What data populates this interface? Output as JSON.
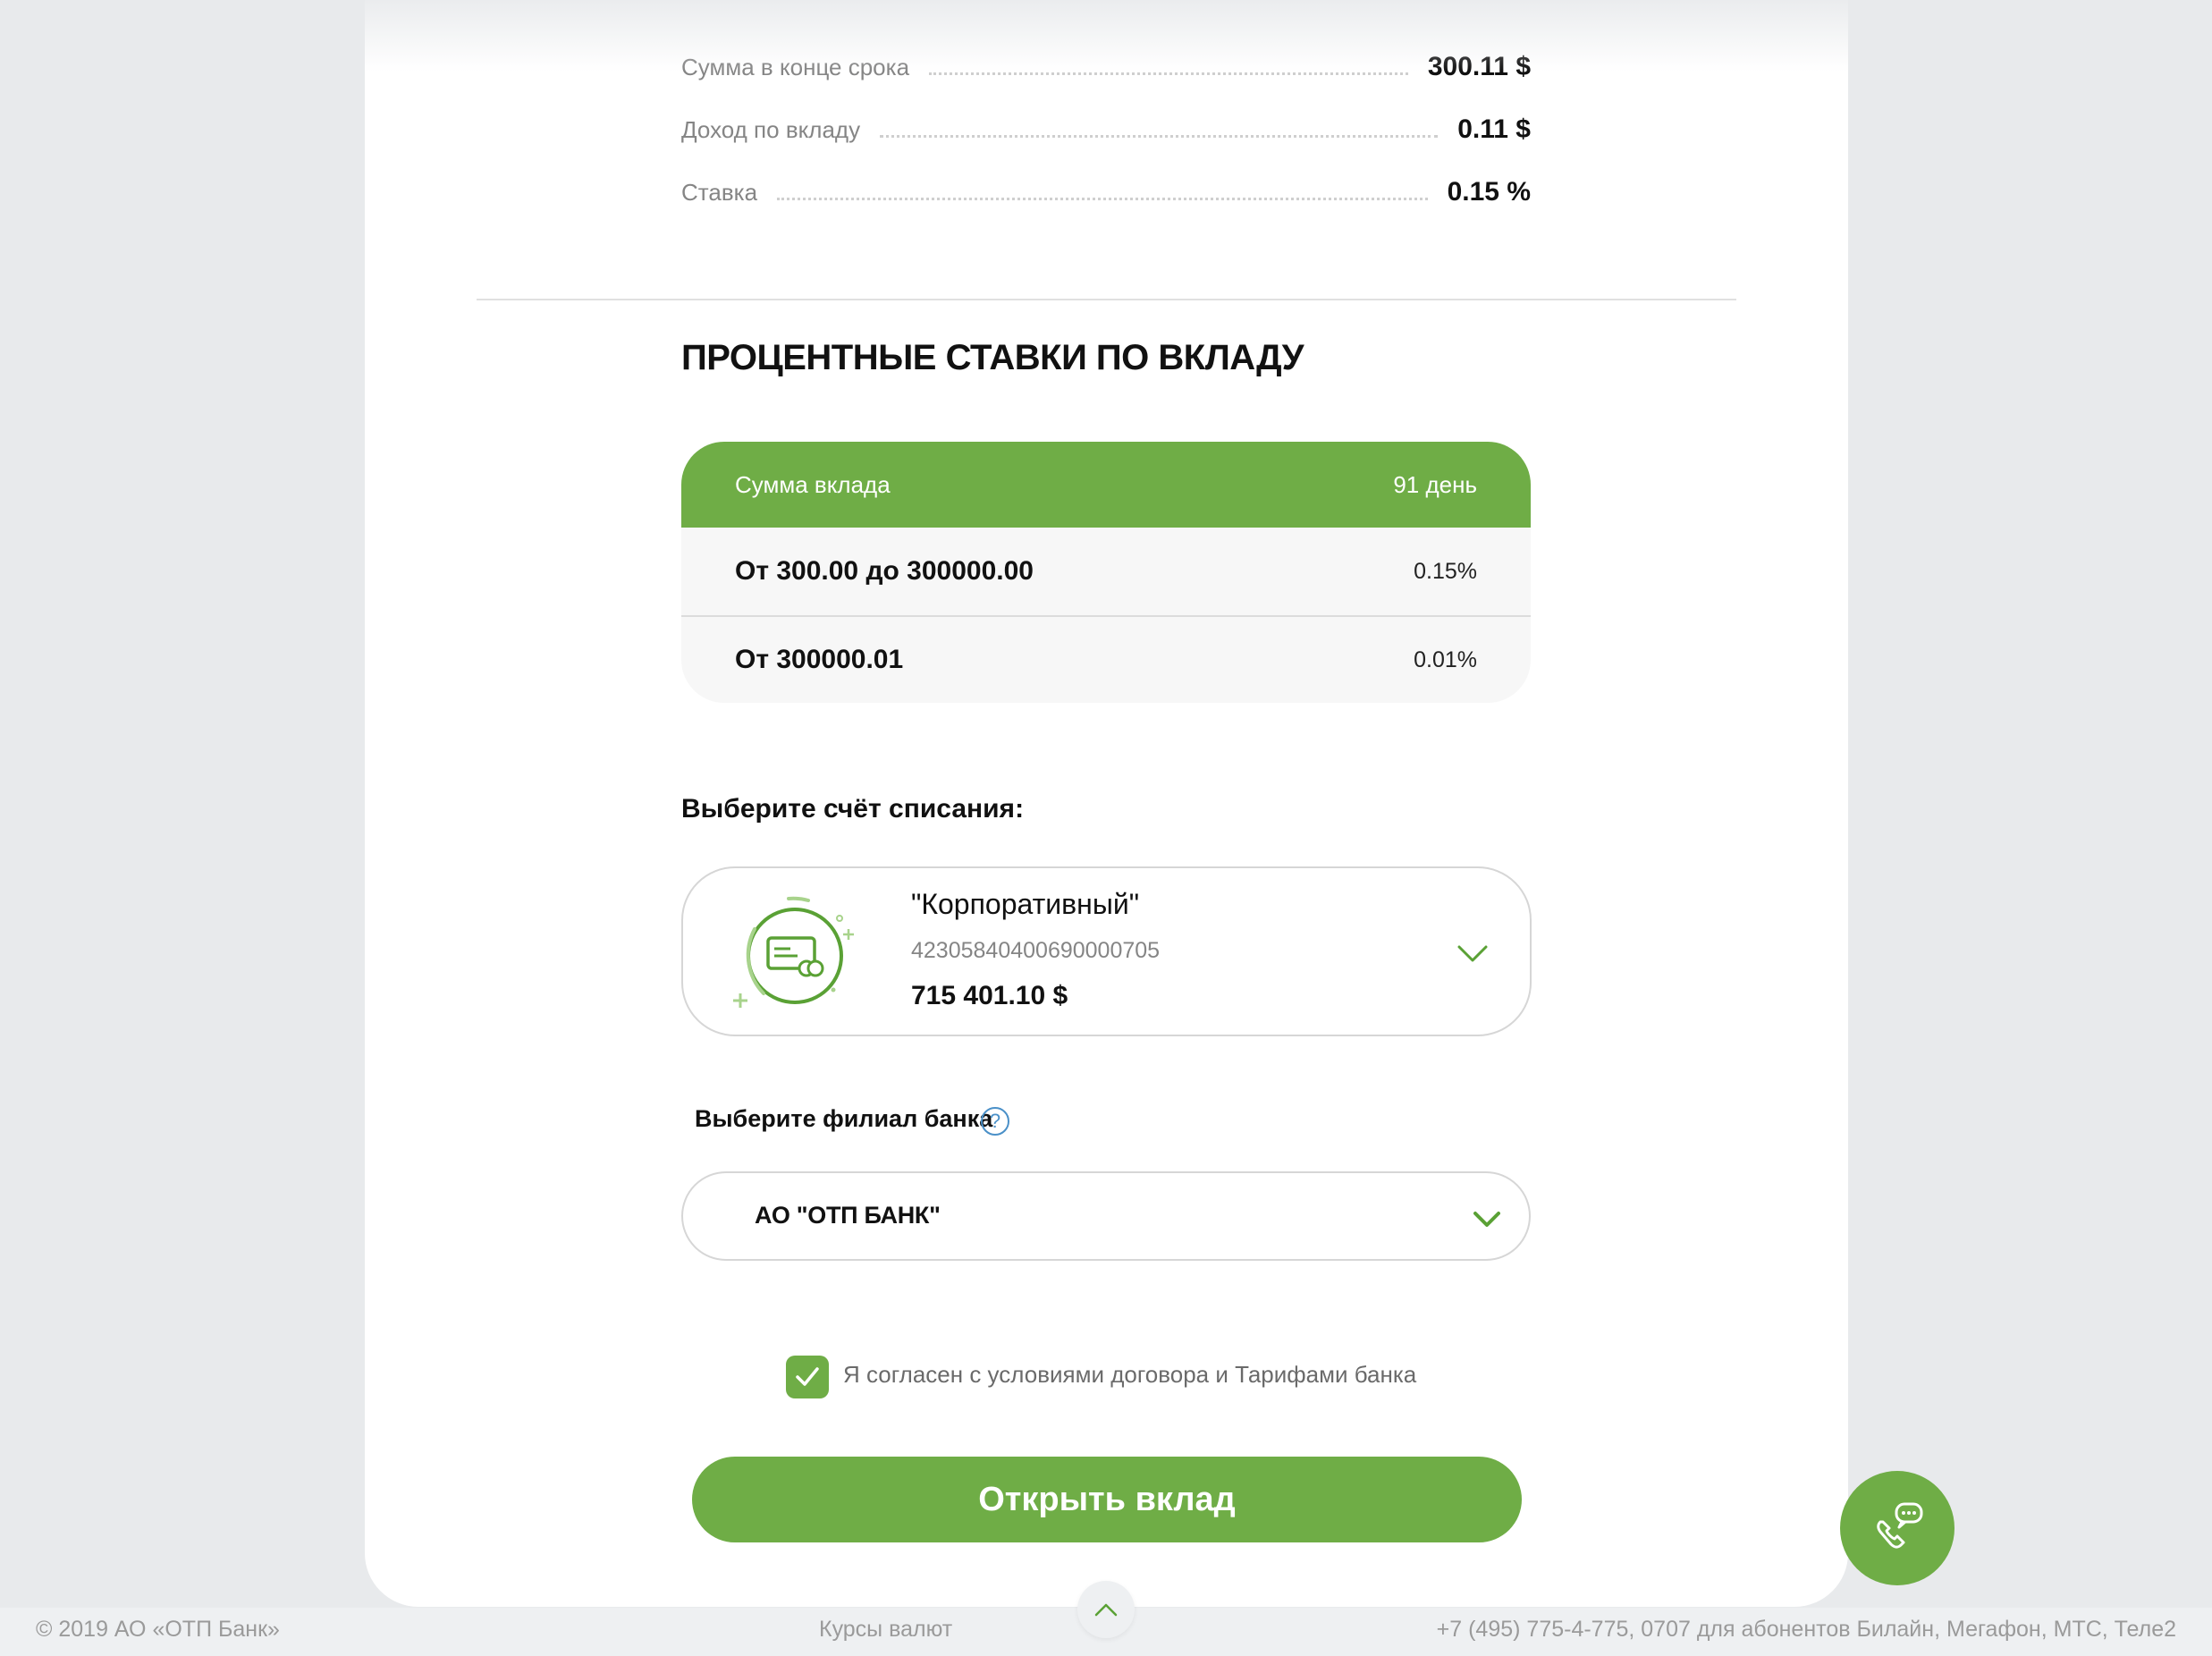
{
  "summary": {
    "rows": [
      {
        "label": "Сумма в конце срока",
        "value": "300.11 $"
      },
      {
        "label": "Доход по вкладу",
        "value": "0.11 $"
      },
      {
        "label": "Ставка",
        "value": "0.15 %"
      }
    ]
  },
  "rates": {
    "title": "ПРОЦЕНТНЫЕ СТАВКИ ПО ВКЛАДУ",
    "header": {
      "amount": "Сумма вклада",
      "term": "91 день"
    },
    "rows": [
      {
        "amount": "От 300.00 до 300000.00",
        "rate": "0.15%"
      },
      {
        "amount": "От 300000.01",
        "rate": "0.01%"
      }
    ]
  },
  "account": {
    "label": "Выберите счёт списания:",
    "name": "\"Корпоративный\"",
    "number": "42305840400690000705",
    "balance": "715 401.10 $",
    "icon": "card-icon"
  },
  "branch": {
    "label": "Выберите филиал банка",
    "help_icon": "?",
    "selected": "АО \"ОТП БАНК\""
  },
  "agreement": {
    "text": "Я согласен с условиями договора и Тарифами банка",
    "checked": true
  },
  "submit": {
    "label": "Открыть вклад"
  },
  "footer": {
    "copyright": "© 2019 АО «ОТП Банк»",
    "rates_link": "Курсы валют",
    "contacts": "+7 (495) 775-4-775,  0707 для абонентов Билайн, Мегафон, МТС, Теле2"
  },
  "colors": {
    "accent": "#6fad46",
    "muted_text": "#858585",
    "help_blue": "#4a90c8"
  }
}
